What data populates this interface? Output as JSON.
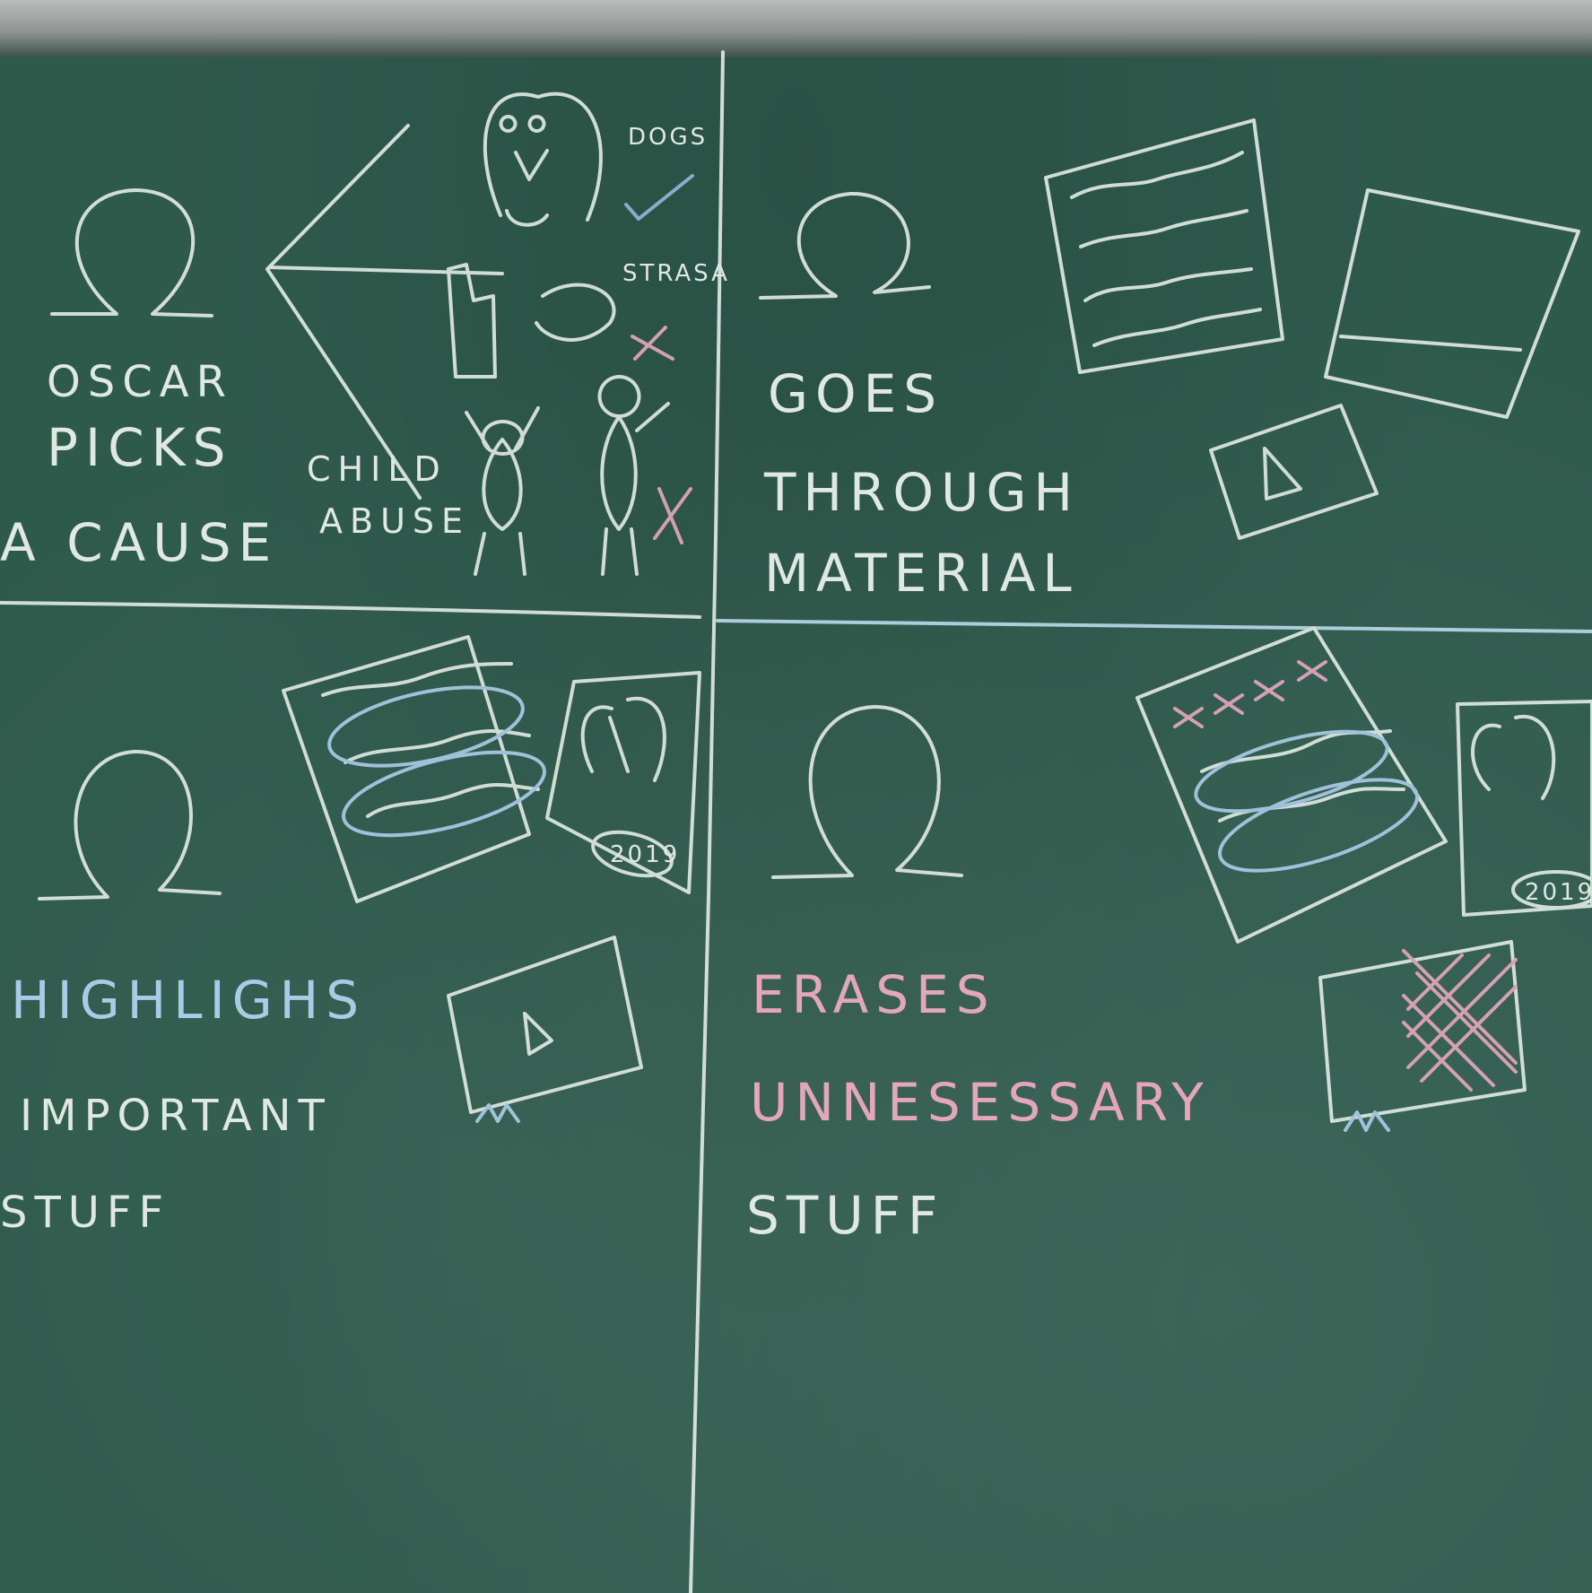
{
  "board": {
    "color": "#2e5a4c",
    "chalk_colors": {
      "white": "#dfe8e3",
      "blue": "#a9cbe6",
      "pink": "#e3a6ba"
    }
  },
  "panels": [
    {
      "id": "top-left",
      "lines": [
        "OSCAR",
        "PICKS",
        "A CAUSE"
      ],
      "labels": {
        "child_abuse_1": "CHILD",
        "child_abuse_2": "ABUSE",
        "dogs": "DOGS",
        "strasa": "STRASA"
      }
    },
    {
      "id": "top-right",
      "lines": [
        "GOES",
        "THROUGH",
        "MATERIAL"
      ]
    },
    {
      "id": "bottom-left",
      "lines": [
        "HIGHLIGHS",
        "IMPORTANT",
        "STUFF"
      ],
      "labels": {
        "year": "2019"
      }
    },
    {
      "id": "bottom-right",
      "lines": [
        "ERASES",
        "UNNESESSARY",
        "STUFF"
      ],
      "labels": {
        "year": "2019"
      }
    }
  ]
}
